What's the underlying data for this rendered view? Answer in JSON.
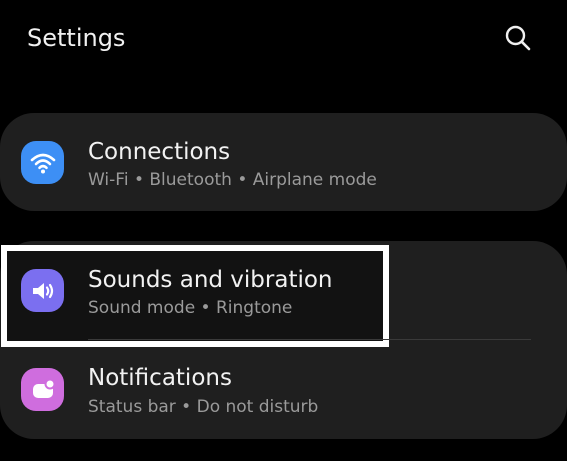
{
  "header": {
    "title": "Settings",
    "search_icon": "search-icon"
  },
  "items": [
    {
      "title": "Connections",
      "subtitle": "Wi-Fi  •  Bluetooth  •  Airplane mode",
      "icon": "wifi-icon",
      "icon_color": "#3d8ff5"
    },
    {
      "title": "Sounds and vibration",
      "subtitle": "Sound mode  •  Ringtone",
      "icon": "volume-icon",
      "icon_color": "#7b6ff0"
    },
    {
      "title": "Notifications",
      "subtitle": "Status bar  •  Do not disturb",
      "icon": "notification-icon",
      "icon_color": "#cf6dde"
    }
  ],
  "colors": {
    "background": "#000000",
    "card": "#1f1f1f",
    "highlight_border": "#ffffff"
  }
}
